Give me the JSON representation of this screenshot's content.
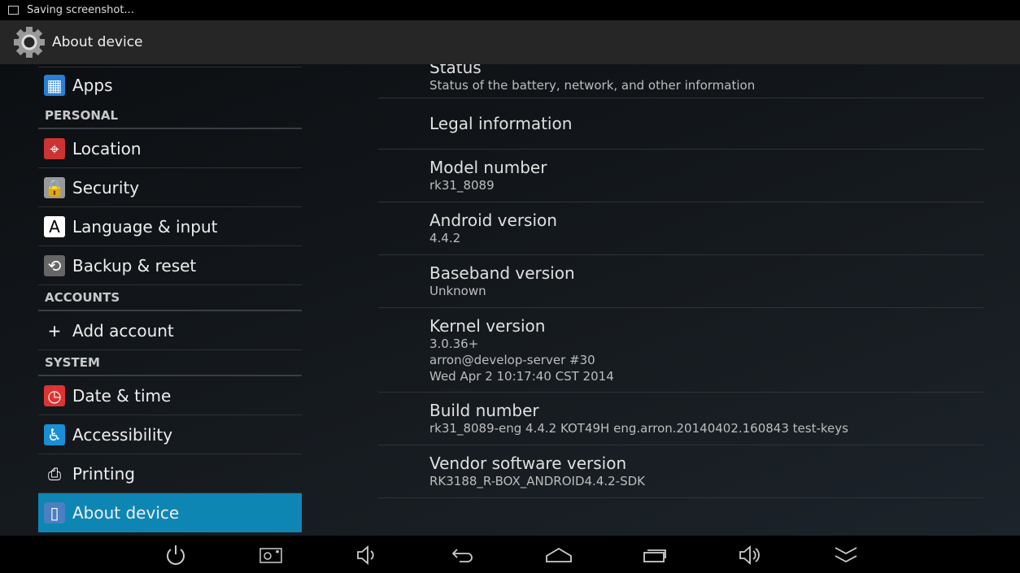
{
  "status_bar": {
    "notification": "Saving screenshot...",
    "icon": "image-icon"
  },
  "action_bar": {
    "title": "About device",
    "icon": "settings-gear-icon"
  },
  "sidebar": {
    "top_item": {
      "label": "Apps",
      "icon": "apps-icon"
    },
    "sections": [
      {
        "header": "PERSONAL",
        "items": [
          {
            "label": "Location",
            "icon": "location-icon"
          },
          {
            "label": "Security",
            "icon": "lock-icon"
          },
          {
            "label": "Language & input",
            "icon": "language-icon"
          },
          {
            "label": "Backup & reset",
            "icon": "backup-icon"
          }
        ]
      },
      {
        "header": "ACCOUNTS",
        "items": [
          {
            "label": "Add account",
            "icon": "plus-icon"
          }
        ]
      },
      {
        "header": "SYSTEM",
        "items": [
          {
            "label": "Date & time",
            "icon": "clock-icon"
          },
          {
            "label": "Accessibility",
            "icon": "accessibility-icon"
          },
          {
            "label": "Printing",
            "icon": "printer-icon"
          },
          {
            "label": "About device",
            "icon": "device-info-icon",
            "selected": true
          }
        ]
      }
    ]
  },
  "details": [
    {
      "title": "Status",
      "summary": [
        "Status of the battery, network, and other information"
      ]
    },
    {
      "title": "Legal information",
      "summary": []
    },
    {
      "title": "Model number",
      "summary": [
        "rk31_8089"
      ]
    },
    {
      "title": "Android version",
      "summary": [
        "4.4.2"
      ]
    },
    {
      "title": "Baseband version",
      "summary": [
        "Unknown"
      ]
    },
    {
      "title": "Kernel version",
      "summary": [
        "3.0.36+",
        "arron@develop-server #30",
        "Wed Apr 2 10:17:40 CST 2014"
      ]
    },
    {
      "title": "Build number",
      "summary": [
        "rk31_8089-eng 4.4.2 KOT49H eng.arron.20140402.160843 test-keys"
      ]
    },
    {
      "title": "Vendor software version",
      "summary": [
        "RK3188_R-BOX_ANDROID4.4.2-SDK"
      ]
    }
  ],
  "nav_bar": [
    "power-icon",
    "screenshot-icon",
    "volume-down-icon",
    "back-icon",
    "home-icon",
    "recent-apps-icon",
    "volume-up-icon",
    "collapse-icon"
  ],
  "colors": {
    "accent": "#0e86b4",
    "action_bar": "#262626"
  }
}
